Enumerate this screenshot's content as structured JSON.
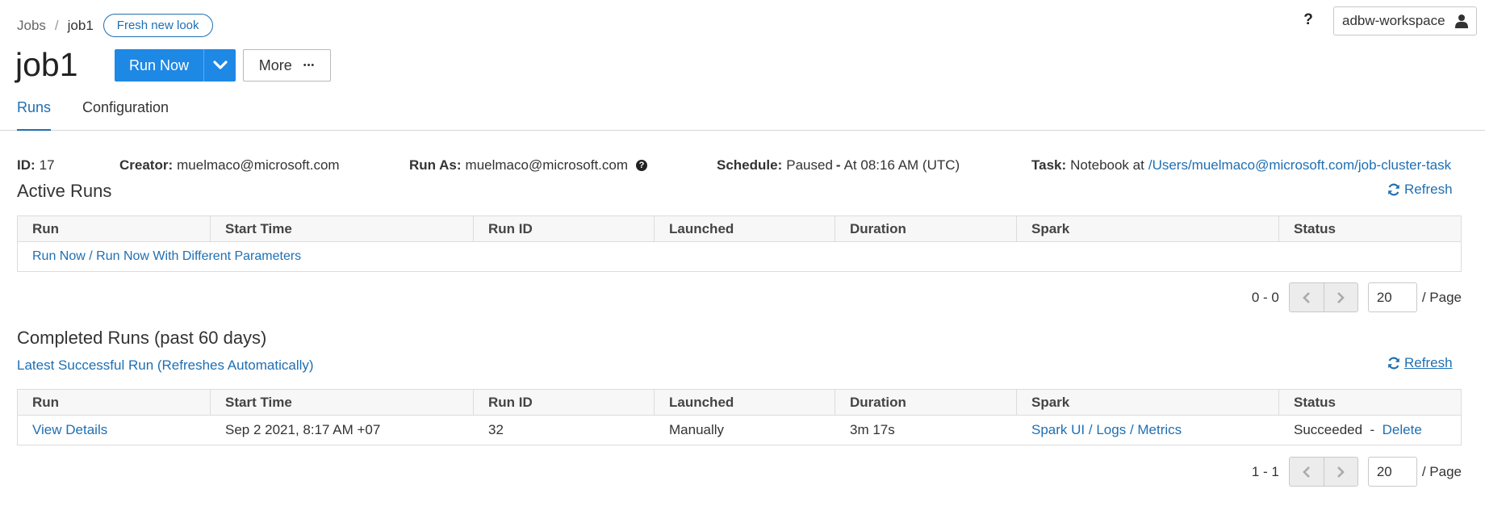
{
  "breadcrumb": {
    "root": "Jobs",
    "separator": "/",
    "current": "job1",
    "badge": "Fresh new look"
  },
  "header": {
    "title": "job1",
    "run_now_label": "Run Now",
    "more_label": "More",
    "more_icon": "•••",
    "help_icon": "?",
    "workspace_label": "adbw-workspace"
  },
  "tabs": [
    {
      "label": "Runs",
      "active": true
    },
    {
      "label": "Configuration",
      "active": false
    }
  ],
  "meta": {
    "id_label": "ID:",
    "id_value": "17",
    "creator_label": "Creator:",
    "creator_value": "muelmaco@microsoft.com",
    "run_as_label": "Run As:",
    "run_as_value": "muelmaco@microsoft.com",
    "schedule_label": "Schedule:",
    "schedule_value": "Paused",
    "schedule_sep": " - ",
    "schedule_time": "At 08:16 AM (UTC)",
    "task_label": "Task:",
    "task_prefix": "Notebook at",
    "task_path": "/Users/muelmaco@microsoft.com/job-cluster-task"
  },
  "columns": [
    "Run",
    "Start Time",
    "Run ID",
    "Launched",
    "Duration",
    "Spark",
    "Status"
  ],
  "active_runs": {
    "title": "Active Runs",
    "refresh_label": "Refresh",
    "run_now_link": "Run Now",
    "link_sep": " / ",
    "run_with_params_link": "Run Now With Different Parameters",
    "pagination": {
      "range": "0 - 0",
      "page_size": "20",
      "per_page": "/ Page"
    }
  },
  "completed_runs": {
    "title": "Completed Runs (past 60 days)",
    "latest_link": "Latest Successful Run (Refreshes Automatically)",
    "refresh_label": "Refresh",
    "rows": [
      {
        "run": "View Details",
        "start_time": "Sep 2 2021, 8:17 AM +07",
        "run_id": "32",
        "launched": "Manually",
        "duration": "3m 17s",
        "spark_ui": "Spark UI",
        "logs": "Logs",
        "metrics": "Metrics",
        "status": "Succeeded",
        "status_sep": " - ",
        "delete": "Delete"
      }
    ],
    "pagination": {
      "range": "1 - 1",
      "page_size": "20",
      "per_page": "/ Page"
    }
  },
  "colors": {
    "accent": "#1e88e5",
    "link": "#1f6fb2",
    "border": "#dcdcdc",
    "header_bg": "#f7f7f7"
  },
  "icons": {
    "caret": "chevron-down-icon",
    "user": "user-icon",
    "refresh": "refresh-icon",
    "prev": "chevron-left-icon",
    "next": "chevron-right-icon",
    "question": "question-circle-icon"
  }
}
